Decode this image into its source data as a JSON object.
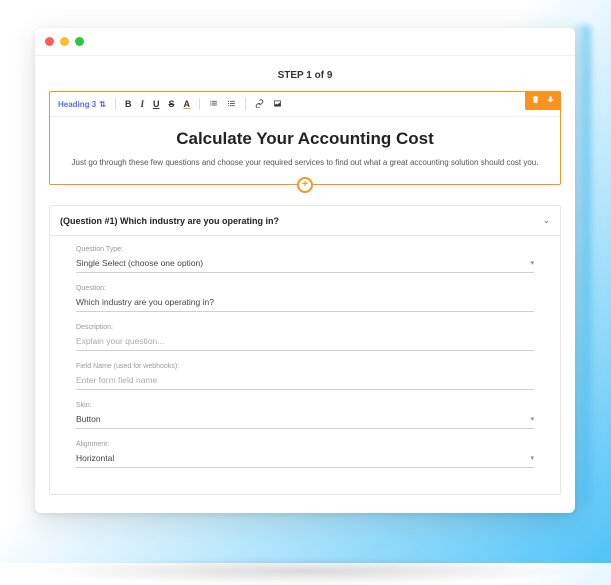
{
  "step_header": "STEP 1 of 9",
  "toolbar": {
    "heading_selector": "Heading 3",
    "bold": "B",
    "italic": "I",
    "underline": "U",
    "strike": "S",
    "color": "A"
  },
  "heading": {
    "title": "Calculate Your Accounting Cost",
    "subtitle": "Just go through these few questions and choose your required services to find out what a great accounting solution should cost you."
  },
  "question": {
    "header": "(Question #1) Which industry are you operating in?",
    "fields": {
      "type_label": "Question Type:",
      "type_value": "Single Select (choose one option)",
      "question_label": "Question:",
      "question_value": "Which industry are you operating in?",
      "description_label": "Description:",
      "description_placeholder": "Explain your question...",
      "fieldname_label": "Field Name (used for webhooks):",
      "fieldname_placeholder": "Enter form field name",
      "skin_label": "Skin:",
      "skin_value": "Button",
      "alignment_label": "Alignment:",
      "alignment_value": "Horizontal"
    }
  }
}
